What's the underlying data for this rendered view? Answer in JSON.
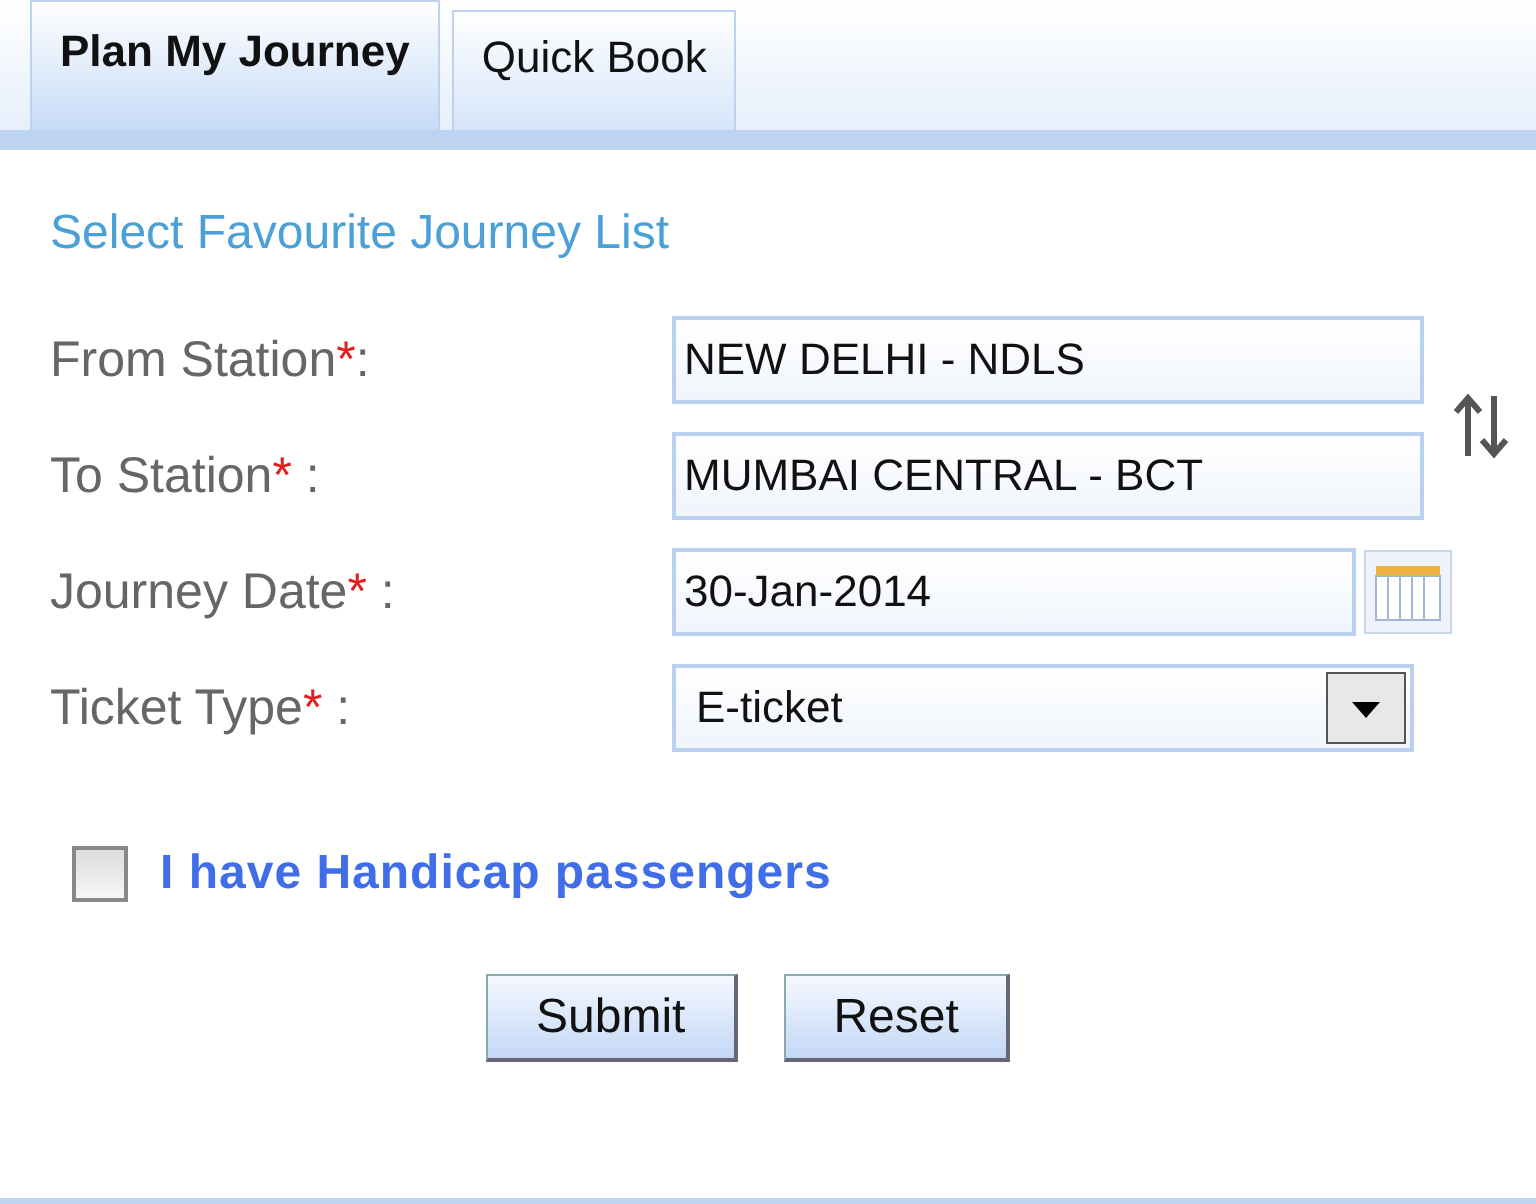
{
  "tabs": [
    {
      "label": "Plan My Journey",
      "selected": true
    },
    {
      "label": "Quick Book",
      "selected": false
    }
  ],
  "favourite_link": "Select Favourite Journey List",
  "fields": [
    {
      "kind": "text",
      "label": "From Station",
      "mark": "*",
      "colon": ":",
      "value": "NEW DELHI - NDLS"
    },
    {
      "kind": "text",
      "label": "To Station",
      "mark": "*",
      "colon": " :",
      "value": "MUMBAI CENTRAL - BCT"
    },
    {
      "kind": "date",
      "label": "Journey Date",
      "mark": "*",
      "colon": " :",
      "value": "30-Jan-2014"
    },
    {
      "kind": "select",
      "label": "Ticket Type",
      "mark": "*",
      "colon": " :",
      "value": "E-ticket"
    }
  ],
  "handicap": {
    "label": "I have Handicap passengers",
    "checked": false
  },
  "buttons": [
    "Submit",
    "Reset"
  ]
}
